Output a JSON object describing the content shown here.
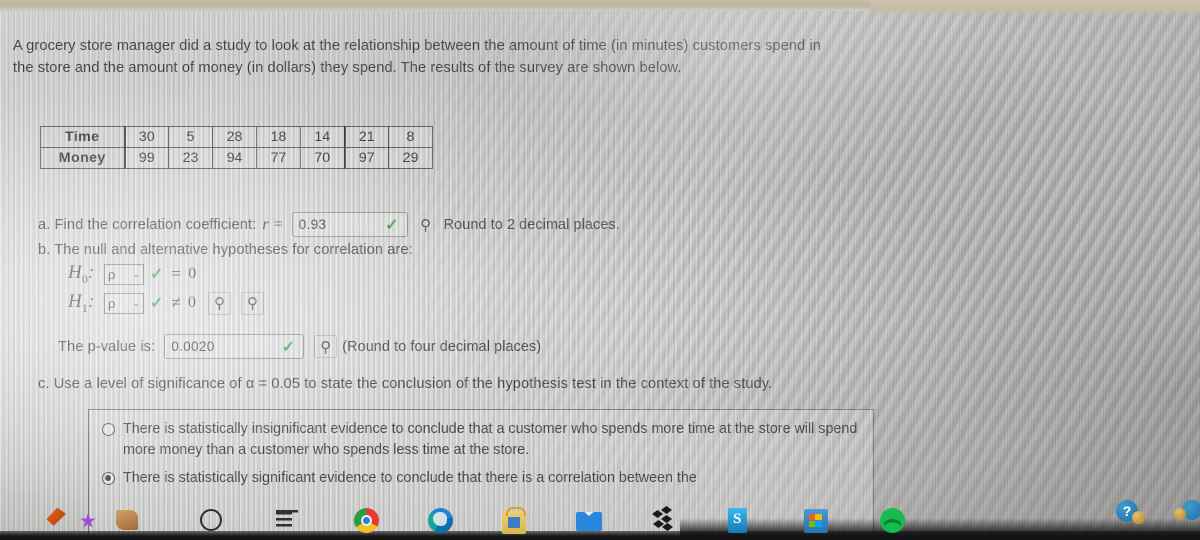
{
  "prompt": {
    "text": "A grocery store manager did a study to look at the relationship between the amount of time (in minutes) customers spend in the store and the amount of money (in dollars) they spend. The results of the survey are shown below."
  },
  "table": {
    "row_labels": [
      "Time",
      "Money"
    ],
    "time": [
      "30",
      "5",
      "28",
      "18",
      "14",
      "21",
      "8"
    ],
    "money": [
      "99",
      "23",
      "94",
      "77",
      "70",
      "97",
      "29"
    ]
  },
  "part_a": {
    "label": "a. Find the correlation coefficient:",
    "symbol": "r =",
    "value": "0.93",
    "check": "✓",
    "key_icon": "⚲",
    "note": "Round to 2 decimal places."
  },
  "part_b": {
    "label": "b. The null and alternative hypotheses for correlation are:",
    "h0_label": "H",
    "h0_sub": "0",
    "h0_select": "ρ",
    "h0_relation": "=",
    "h0_value": "0",
    "h1_label": "H",
    "h1_sub": "1",
    "h1_select": "ρ",
    "h1_relation": "≠",
    "h1_value": "0",
    "caret": "⌄",
    "check": "✓",
    "key_icon": "⚲"
  },
  "pvalue": {
    "label": "The p-value is:",
    "value": "0.0020",
    "check": "✓",
    "key_icon": "⚲",
    "note": "(Round to four decimal places)"
  },
  "part_c": {
    "text": "c. Use a level of significance of α = 0.05 to state the conclusion of the hypothesis test in the context of the study.",
    "alpha": "0.05",
    "choices": [
      {
        "selected": false,
        "text": "There is statistically insignificant evidence to conclude that a customer who spends more time at the store will spend more money than a customer who spends less time at the store."
      },
      {
        "selected": true,
        "text": "There is statistically significant evidence to conclude that there is a correlation between the"
      }
    ]
  },
  "taskbar": {
    "icons": [
      "paint-icon",
      "star-icon",
      "pen-icon",
      "circle-icon",
      "lines-icon",
      "chrome-icon",
      "edge-icon",
      "store-bag-icon",
      "mail-icon",
      "dropbox-icon",
      "skype-icon",
      "microsoft-store-icon",
      "spotify-icon"
    ]
  },
  "overlay": {
    "help_badge": "?"
  },
  "colors": {
    "check_green": "#2f9c3a",
    "text": "#303133",
    "screen_bg": "#c9c9c7",
    "accent_blue": "#2e86d6"
  }
}
